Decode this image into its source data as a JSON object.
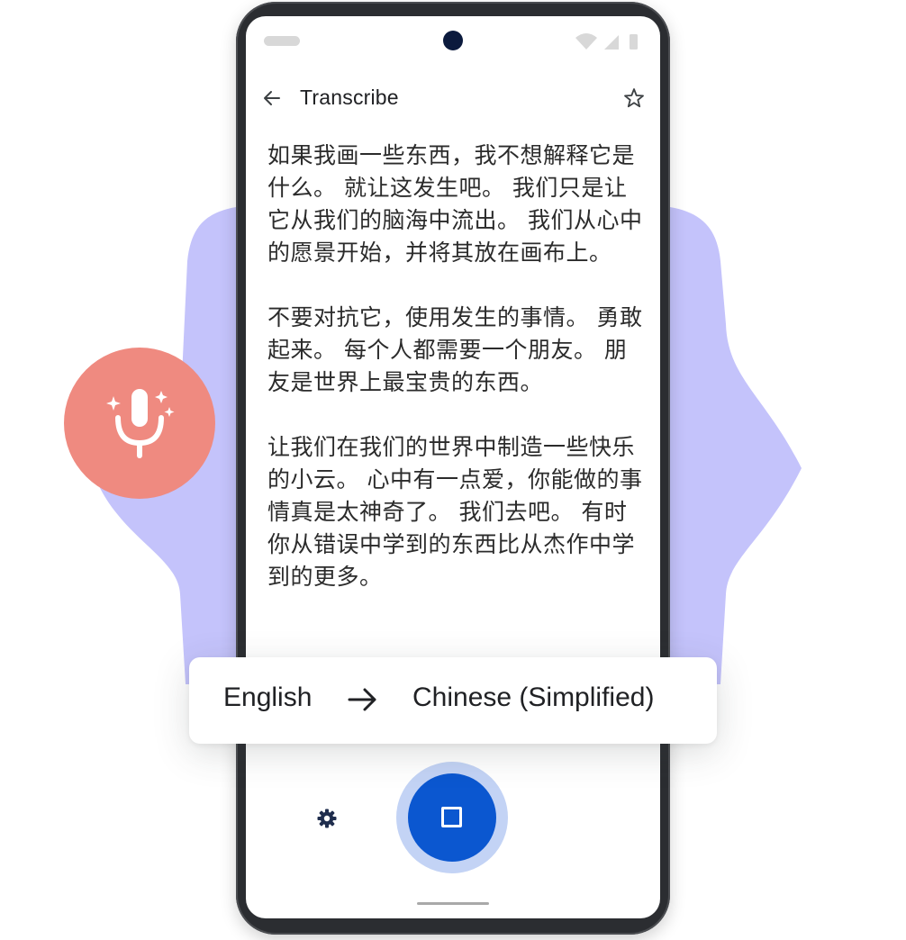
{
  "appbar": {
    "title": "Transcribe",
    "back_icon": "arrow-back-icon",
    "star_icon": "star-outline-icon"
  },
  "transcript": {
    "paragraphs": [
      "如果我画一些东西，我不想解释它是什么。 就让这发生吧。 我们只是让它从我们的脑海中流出。 我们从心中的愿景开始，并将其放在画布上。",
      "不要对抗它，使用发生的事情。 勇敢起来。 每个人都需要一个朋友。 朋友是世界上最宝贵的东西。",
      "让我们在我们的世界中制造一些快乐的小云。 心中有一点爱，你能做的事情真是太神奇了。 我们去吧。 有时你从错误中学到的东西比从杰作中学到的更多。"
    ]
  },
  "language_card": {
    "from": "English",
    "to": "Chinese (Simplified)",
    "arrow_icon": "arrow-right-icon"
  },
  "controls": {
    "settings_icon": "gear-icon",
    "record_icon": "stop-icon"
  },
  "colors": {
    "blob": "#c4c3fb",
    "mic_circle": "#ef8a80",
    "record_button": "#0b57d0",
    "record_ring": "#c3d3f5",
    "phone_frame": "#2b2d31"
  }
}
